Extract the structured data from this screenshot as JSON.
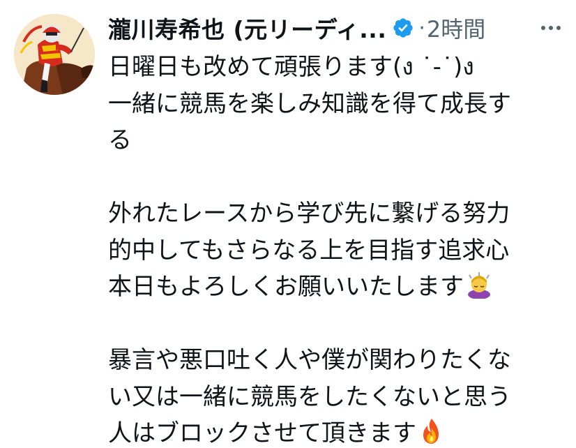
{
  "post": {
    "author": {
      "display_name": "瀧川寿希也 (元リーディ...",
      "verified": true,
      "avatar_icon": "jockey-on-horse-avatar"
    },
    "separator": "·",
    "timestamp": "2時間",
    "more_icon": "more-horizontal-icon",
    "text_lines": [
      "日曜日も改めて頑張ります(ง ˙-˙)ง",
      "一緒に競馬を楽しみ知識を得て成長す",
      "る",
      "外れたレースから学び先に繋げる努力",
      "的中してもさらなる上を目指す追求心",
      "本日もよろしくお願いいたします",
      "暴言や悪口吐く人や僕が関わりたくな",
      "い又は一緒に競馬をしたくないと思う",
      "人はブロックさせて頂きます"
    ],
    "emojis": {
      "bow": "person-bowing-emoji",
      "fire": "fire-emoji"
    }
  },
  "colors": {
    "text": "#0f1419",
    "secondary": "#536471",
    "verified_blue": "#1d9bf0"
  }
}
